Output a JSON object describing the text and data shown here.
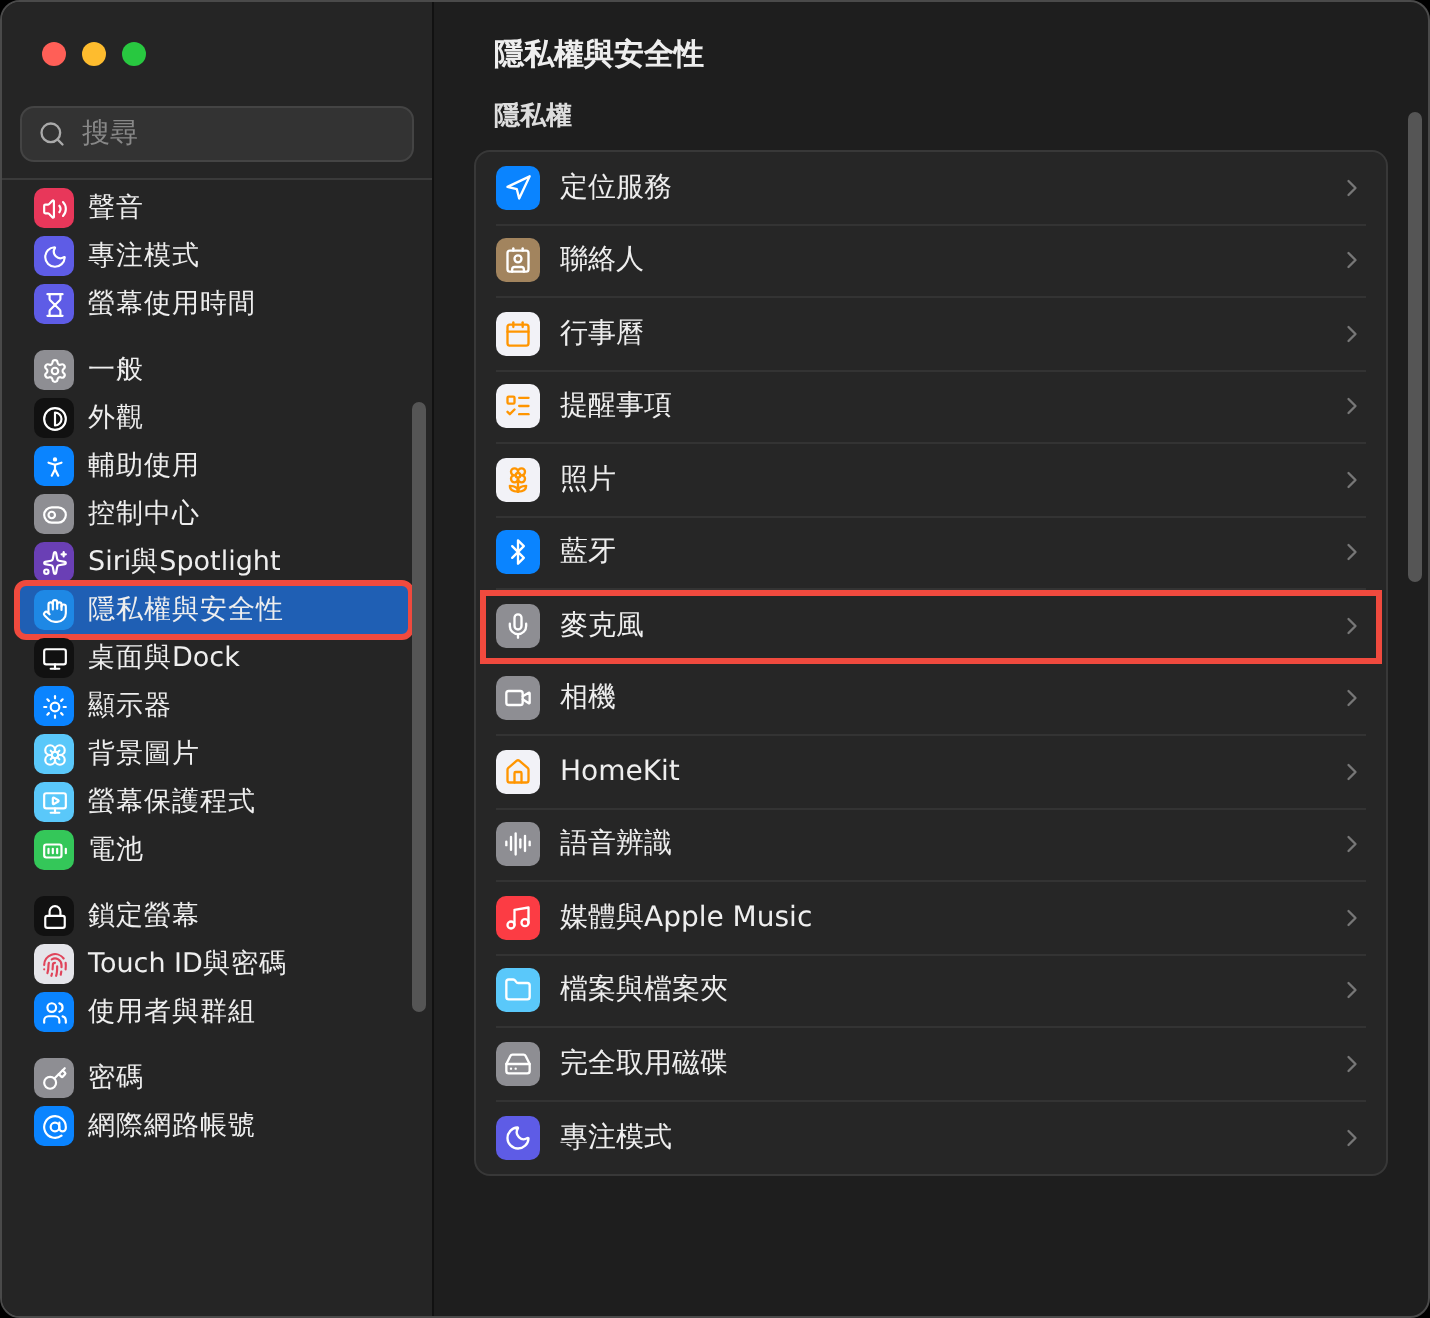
{
  "window": {
    "title": "隱私權與安全性"
  },
  "search": {
    "placeholder": "搜尋"
  },
  "sidebar": {
    "groups": [
      {
        "items": [
          {
            "label": "聲音",
            "selected": false,
            "highlighted": false,
            "color": "#e8375a"
          },
          {
            "label": "專注模式",
            "selected": false,
            "highlighted": false,
            "color": "#5e5ce6"
          },
          {
            "label": "螢幕使用時間",
            "selected": false,
            "highlighted": false,
            "color": "#5e5ce6"
          }
        ]
      },
      {
        "items": [
          {
            "label": "一般",
            "selected": false,
            "highlighted": false,
            "color": "#8e8e93"
          },
          {
            "label": "外觀",
            "selected": false,
            "highlighted": false,
            "color": "#111111"
          },
          {
            "label": "輔助使用",
            "selected": false,
            "highlighted": false,
            "color": "#0a84ff"
          },
          {
            "label": "控制中心",
            "selected": false,
            "highlighted": false,
            "color": "#8e8e93"
          },
          {
            "label": "Siri與Spotlight",
            "selected": false,
            "highlighted": false,
            "color": "#6a3fb5"
          },
          {
            "label": "隱私權與安全性",
            "selected": true,
            "highlighted": true,
            "color": "#1e88e5"
          },
          {
            "label": "桌面與Dock",
            "selected": false,
            "highlighted": false,
            "color": "#111111"
          },
          {
            "label": "顯示器",
            "selected": false,
            "highlighted": false,
            "color": "#0a84ff"
          },
          {
            "label": "背景圖片",
            "selected": false,
            "highlighted": false,
            "color": "#5ac8fa"
          },
          {
            "label": "螢幕保護程式",
            "selected": false,
            "highlighted": false,
            "color": "#5ac8fa"
          },
          {
            "label": "電池",
            "selected": false,
            "highlighted": false,
            "color": "#34c759"
          }
        ]
      },
      {
        "items": [
          {
            "label": "鎖定螢幕",
            "selected": false,
            "highlighted": false,
            "color": "#111111"
          },
          {
            "label": "Touch ID與密碼",
            "selected": false,
            "highlighted": false,
            "color": "#e5e5ea"
          },
          {
            "label": "使用者與群組",
            "selected": false,
            "highlighted": false,
            "color": "#0a84ff"
          }
        ]
      },
      {
        "items": [
          {
            "label": "密碼",
            "selected": false,
            "highlighted": false,
            "color": "#8e8e93"
          },
          {
            "label": "網際網路帳號",
            "selected": false,
            "highlighted": false,
            "color": "#0a84ff"
          }
        ]
      }
    ]
  },
  "section": {
    "title": "隱私權",
    "rows": [
      {
        "label": "定位服務",
        "highlighted": false,
        "color": "#0a84ff"
      },
      {
        "label": "聯絡人",
        "highlighted": false,
        "color": "#a2845e"
      },
      {
        "label": "行事曆",
        "highlighted": false,
        "color": "#f2f2f7"
      },
      {
        "label": "提醒事項",
        "highlighted": false,
        "color": "#f2f2f7"
      },
      {
        "label": "照片",
        "highlighted": false,
        "color": "#f2f2f7"
      },
      {
        "label": "藍牙",
        "highlighted": false,
        "color": "#0a84ff"
      },
      {
        "label": "麥克風",
        "highlighted": true,
        "color": "#8e8e93"
      },
      {
        "label": "相機",
        "highlighted": false,
        "color": "#8e8e93"
      },
      {
        "label": "HomeKit",
        "highlighted": false,
        "color": "#f2f2f7"
      },
      {
        "label": "語音辨識",
        "highlighted": false,
        "color": "#8e8e93"
      },
      {
        "label": "媒體與Apple Music",
        "highlighted": false,
        "color": "#fc3c44"
      },
      {
        "label": "檔案與檔案夾",
        "highlighted": false,
        "color": "#5ac8fa"
      },
      {
        "label": "完全取用磁碟",
        "highlighted": false,
        "color": "#8e8e93"
      },
      {
        "label": "專注模式",
        "highlighted": false,
        "color": "#5e5ce6"
      }
    ]
  }
}
